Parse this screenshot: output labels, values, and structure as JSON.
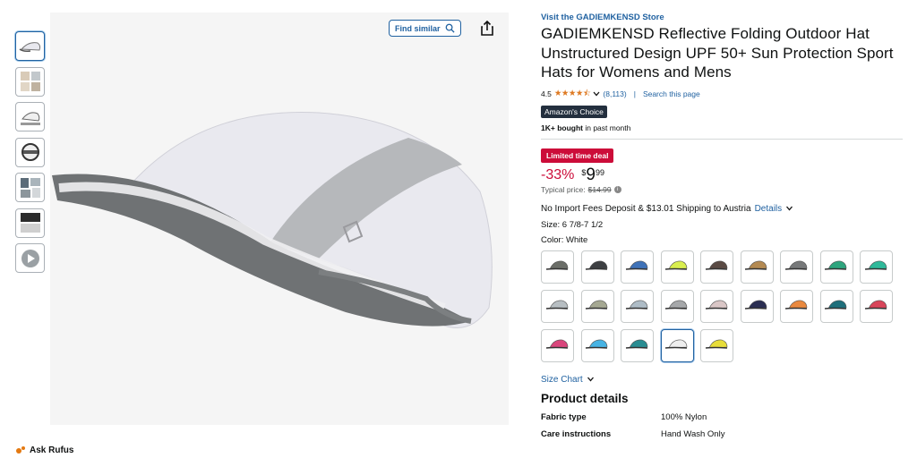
{
  "thumbnails": [
    {
      "icon": "cap-white-side-icon",
      "active": true
    },
    {
      "icon": "product-collage-icon",
      "active": false
    },
    {
      "icon": "cap-features-icon",
      "active": false
    },
    {
      "icon": "cap-folded-icon",
      "active": false
    },
    {
      "icon": "cap-lifestyle-icon",
      "active": false
    },
    {
      "icon": "cap-detail-icon",
      "active": false
    },
    {
      "icon": "video-thumbnail-icon",
      "active": false
    }
  ],
  "image_actions": {
    "find_similar_label": "Find similar"
  },
  "ask_rufus_label": "Ask Rufus",
  "product": {
    "store_link": "Visit the GADIEMKENSD Store",
    "title": "GADIEMKENSD Reflective Folding Outdoor Hat Unstructured Design UPF 50+ Sun Protection Sport Hats for Womens and Mens",
    "rating_value": "4.5",
    "rating_stars": "★★★★⯪",
    "rating_count": "(8,113)",
    "search_page": "Search this page",
    "badge": "Amazon's Choice",
    "bought_bold": "1K+ bought",
    "bought_rest": " in past month",
    "deal_badge": "Limited time deal",
    "discount": "-33%",
    "price_symbol": "$",
    "price_whole": "9",
    "price_fraction": "99",
    "typical_label": "Typical price: ",
    "typical_price": "$14.99",
    "shipping_text": "No Import Fees Deposit & $13.01 Shipping to Austria",
    "shipping_details": "Details",
    "size_label": "Size: ",
    "size_value": "6 7/8-7 1/2",
    "color_label": "Color: ",
    "color_value": "White",
    "size_chart": "Size Chart",
    "details_heading": "Product details",
    "specs": [
      {
        "key": "Fabric type",
        "value": "100% Nylon"
      },
      {
        "key": "Care instructions",
        "value": "Hand Wash Only"
      }
    ]
  },
  "swatches": [
    {
      "color": "#6b6e68",
      "selected": false
    },
    {
      "color": "#3d3f42",
      "selected": false
    },
    {
      "color": "#3f72b8",
      "selected": false
    },
    {
      "color": "#d9ee4f",
      "selected": false
    },
    {
      "color": "#5a4a44",
      "selected": false
    },
    {
      "color": "#b48a52",
      "selected": false
    },
    {
      "color": "#77797a",
      "selected": false
    },
    {
      "color": "#2ea57e",
      "selected": false
    },
    {
      "color": "#2fb99a",
      "selected": false
    },
    {
      "color": "#b7bec2",
      "selected": false
    },
    {
      "color": "#a5a892",
      "selected": false
    },
    {
      "color": "#aebcc6",
      "selected": false
    },
    {
      "color": "#a6a8aa",
      "selected": false
    },
    {
      "color": "#d9c6c6",
      "selected": false
    },
    {
      "color": "#2a2e52",
      "selected": false
    },
    {
      "color": "#e9893f",
      "selected": false
    },
    {
      "color": "#1f6f7b",
      "selected": false
    },
    {
      "color": "#d8455a",
      "selected": false
    },
    {
      "color": "#d9467c",
      "selected": false
    },
    {
      "color": "#47b3e3",
      "selected": false
    },
    {
      "color": "#2a8d92",
      "selected": false
    },
    {
      "color": "#eeeeee",
      "selected": true
    },
    {
      "color": "#e7dd3a",
      "selected": false
    }
  ]
}
